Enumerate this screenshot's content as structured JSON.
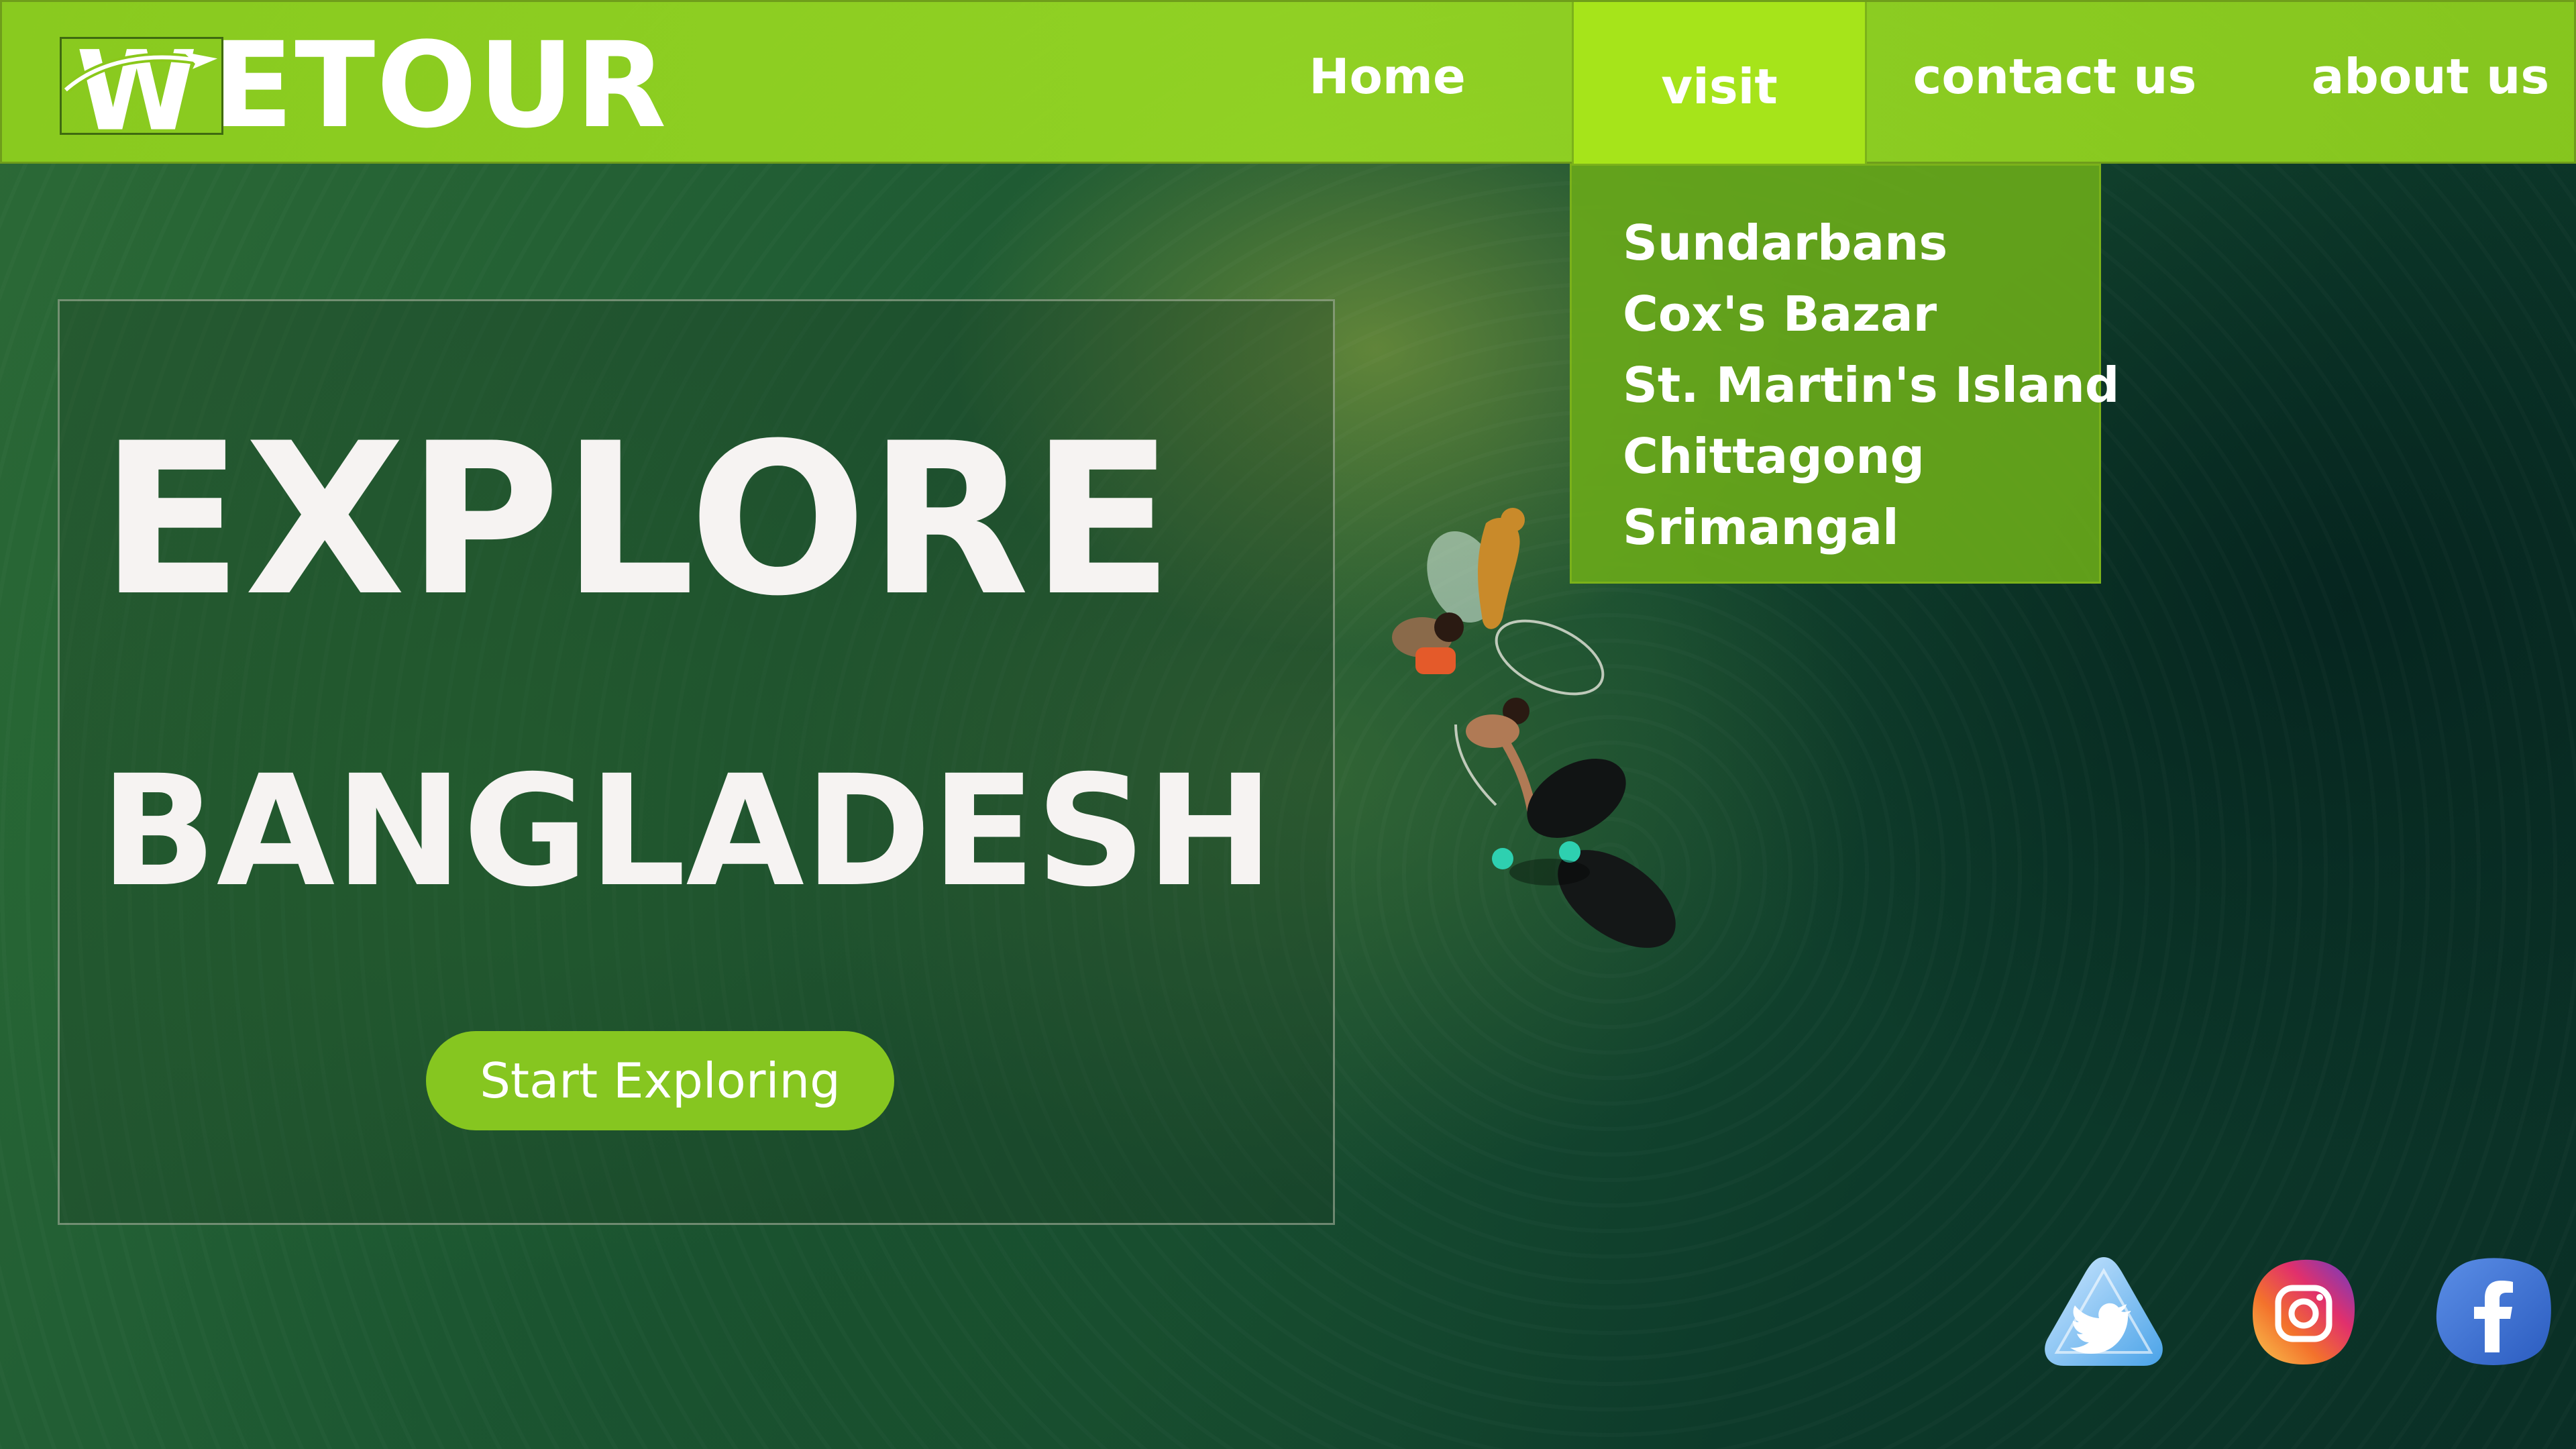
{
  "brand": {
    "logo_letter": "W",
    "logo_text": "ETOUR"
  },
  "nav": {
    "home": "Home",
    "visit": "visit",
    "contact": "contact us",
    "about": "about us"
  },
  "dropdown": {
    "items": [
      "Sundarbans",
      "Cox's Bazar",
      "St. Martin's Island",
      "Chittagong",
      "Srimangal"
    ]
  },
  "hero": {
    "title_line1": "EXPLORE",
    "title_line2": "BANGLADESH",
    "cta_label": "Start Exploring"
  },
  "social": {
    "icons": [
      "twitter-icon",
      "instagram-icon",
      "facebook-icon"
    ]
  },
  "colors": {
    "header_green": "#96d723",
    "visit_highlight": "#a6e41a",
    "dropdown_green": "#68a81a",
    "cta_green": "#86c620",
    "text_light": "#f6f3f2"
  }
}
